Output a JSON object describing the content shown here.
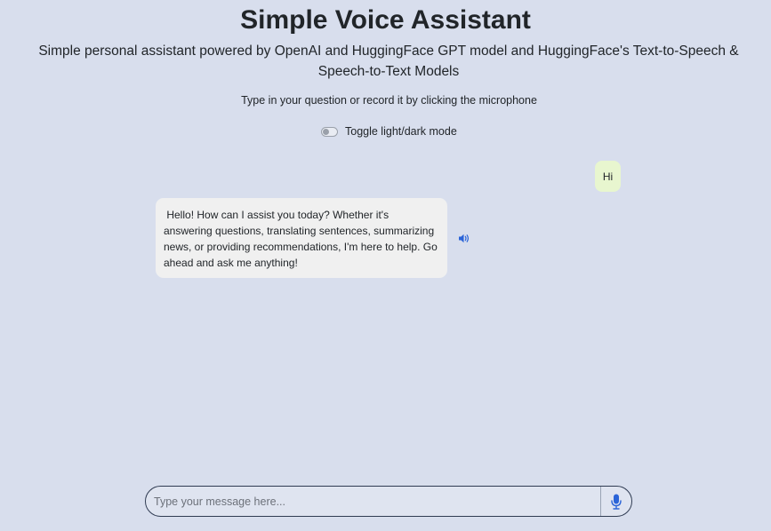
{
  "header": {
    "title": "Simple Voice Assistant",
    "subtitle": "Simple personal assistant powered by OpenAI and HuggingFace GPT model and HuggingFace's Text-to-Speech & Speech-to-Text Models",
    "instruction": "Type in your question or record it by clicking the microphone"
  },
  "theme_toggle": {
    "label": "Toggle light/dark mode",
    "checked": false
  },
  "chat": {
    "messages": [
      {
        "role": "user",
        "text": "Hi"
      },
      {
        "role": "assistant",
        "text": " Hello! How can I assist you today? Whether it's answering questions, translating sentences, summarizing news, or providing recommendations, I'm here to help. Go ahead and ask me anything!"
      }
    ]
  },
  "composer": {
    "placeholder": "Type your message here...",
    "value": ""
  },
  "icons": {
    "speaker": "speaker-icon",
    "microphone": "microphone-icon"
  },
  "colors": {
    "background": "#d8deed",
    "user_bubble": "#e8f6cf",
    "assistant_bubble": "#f0f0f0",
    "accent": "#2b64d8"
  }
}
